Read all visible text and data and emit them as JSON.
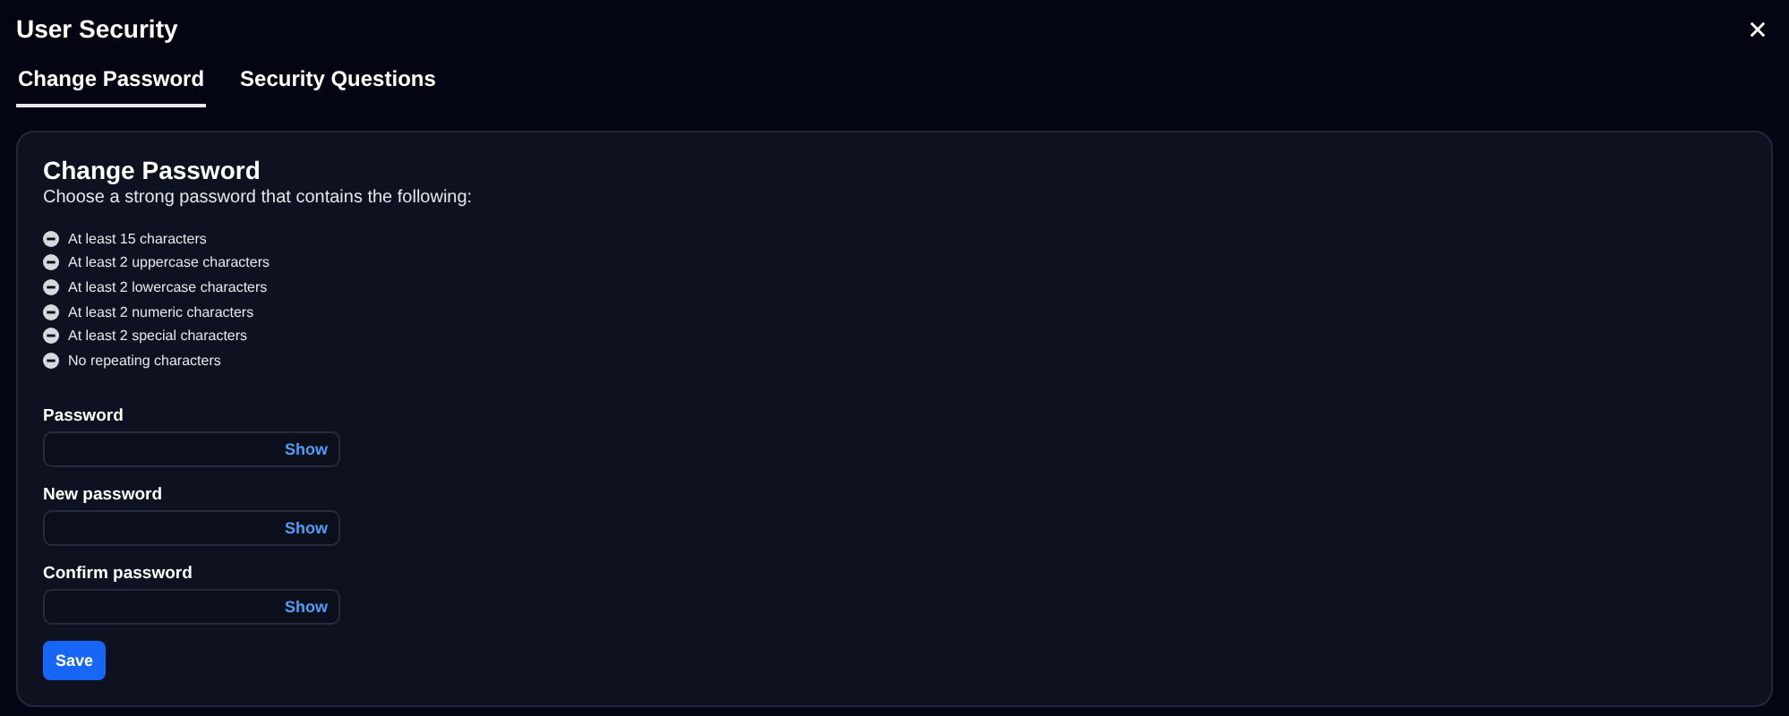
{
  "window": {
    "title": "User Security"
  },
  "tabs": [
    {
      "label": "Change Password",
      "selected": true
    },
    {
      "label": "Security Questions",
      "selected": false
    }
  ],
  "panel": {
    "title": "Change Password",
    "subtitle": "Choose a strong password that contains the following:",
    "requirements": [
      {
        "text": "At least 15 characters",
        "met": false
      },
      {
        "text": "At least 2 uppercase characters",
        "met": false
      },
      {
        "text": "At least 2 lowercase characters",
        "met": false
      },
      {
        "text": "At least 2 numeric characters",
        "met": false
      },
      {
        "text": "At least 2 special characters",
        "met": false
      },
      {
        "text": "No repeating characters",
        "met": false
      }
    ],
    "fields": [
      {
        "label": "Password",
        "toggle": "Show"
      },
      {
        "label": "New password",
        "toggle": "Show"
      },
      {
        "label": "Confirm password",
        "toggle": "Show"
      }
    ],
    "save_button": "Save"
  }
}
